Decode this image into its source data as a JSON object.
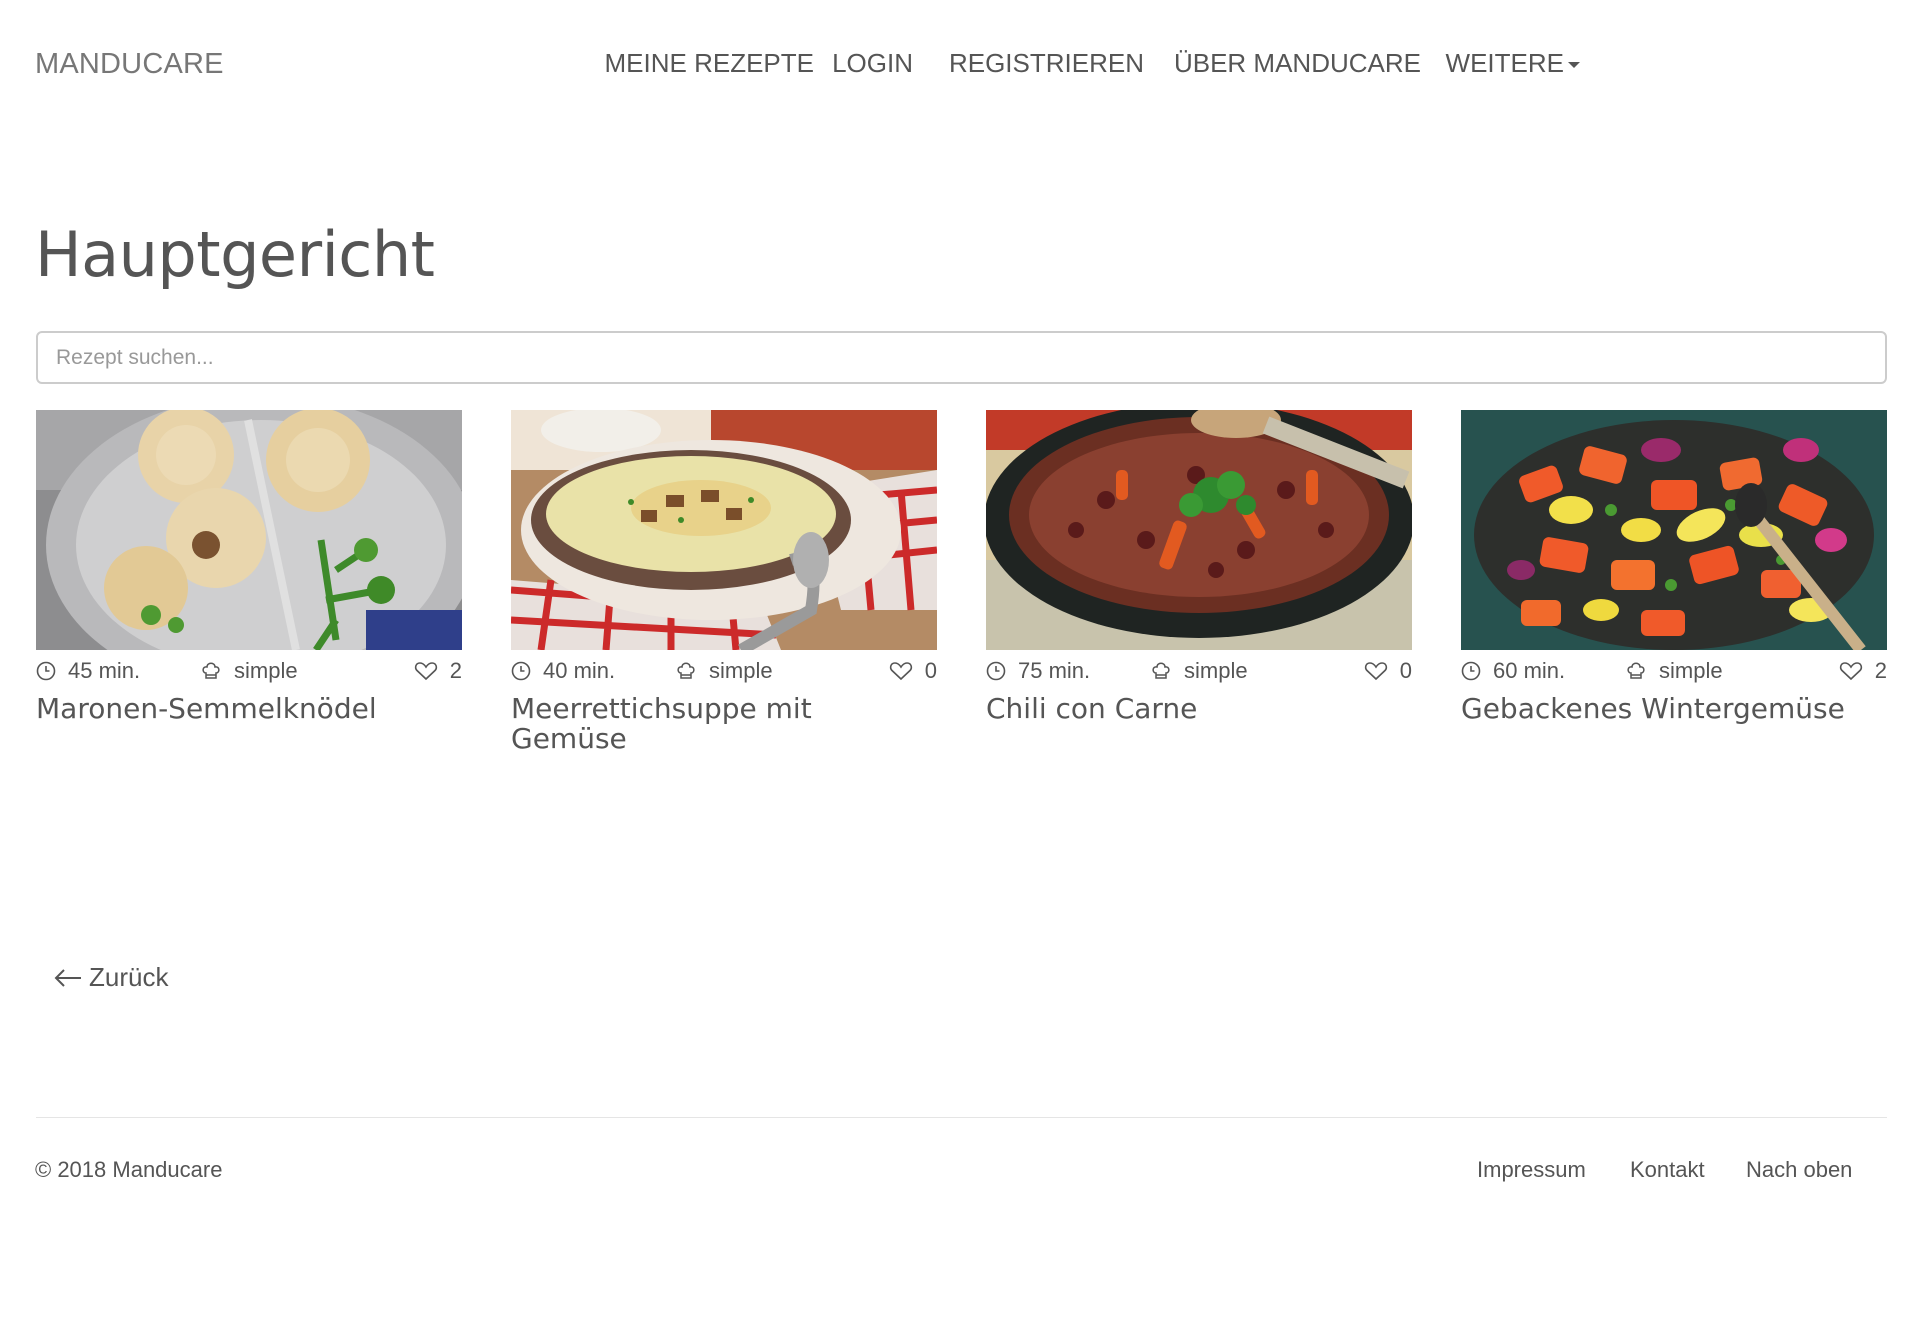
{
  "brand": "MANDUCARE",
  "nav": {
    "items": [
      "MEINE REZEPTE",
      "LOGIN",
      "REGISTRIEREN",
      "ÜBER MANDUCARE"
    ],
    "more": "WEITERE"
  },
  "page_title": "Hauptgericht",
  "search": {
    "placeholder": "Rezept suchen...",
    "value": ""
  },
  "recipes": [
    {
      "time": "45 min.",
      "difficulty": "simple",
      "likes": "2",
      "title": "Maronen-Semmelknödel",
      "image": "dumplings-photo"
    },
    {
      "time": "40 min.",
      "difficulty": "simple",
      "likes": "0",
      "title": "Meerrettichsuppe mit Gemüse",
      "image": "horseradish-soup-photo"
    },
    {
      "time": "75 min.",
      "difficulty": "simple",
      "likes": "0",
      "title": "Chili con Carne",
      "image": "chili-photo"
    },
    {
      "time": "60 min.",
      "difficulty": "simple",
      "likes": "2",
      "title": "Gebackenes Wintergemüse",
      "image": "roasted-vegetables-photo"
    }
  ],
  "back_label": "Zurück",
  "footer": {
    "copyright": "© 2018 Manducare",
    "links": [
      "Impressum",
      "Kontakt",
      "Nach oben"
    ]
  },
  "icons": {
    "time": "clock-icon",
    "difficulty": "chef-hat-icon",
    "likes": "heart-icon",
    "back": "arrow-left-icon"
  },
  "colors": {
    "text": "#555555",
    "brand": "#777777",
    "border": "#cccccc",
    "divider": "#e5e5e5"
  }
}
